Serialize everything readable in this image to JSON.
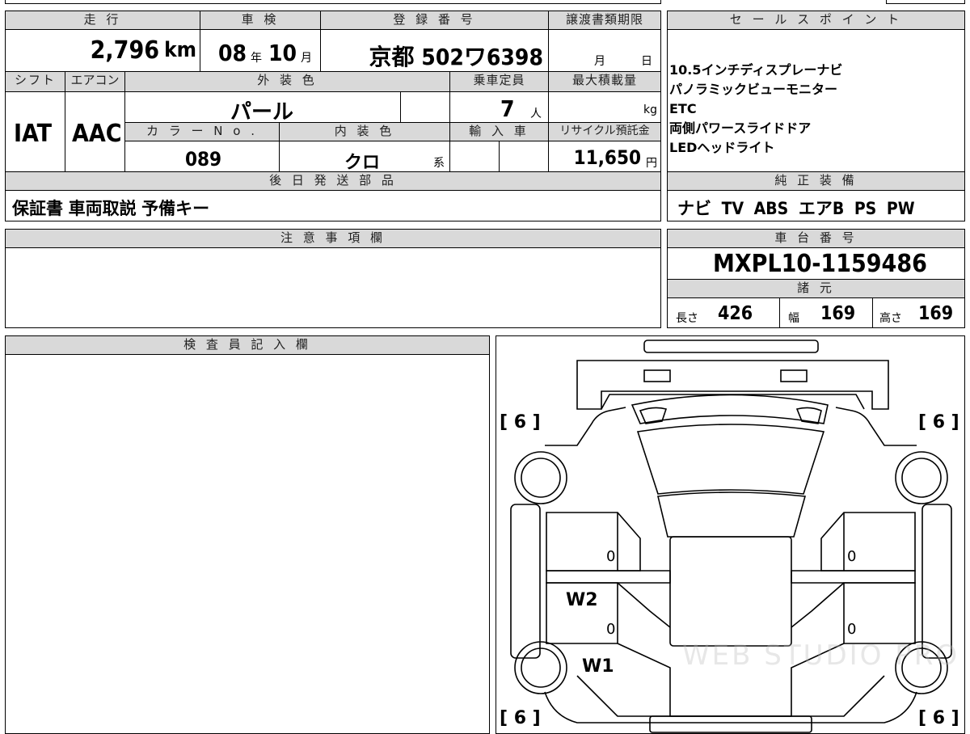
{
  "headers": {
    "mileage": "走 行",
    "inspection": "車 検",
    "registration": "登 録 番 号",
    "transfer_deadline": "譲渡書類期限",
    "sales_points": "セ ー ル ス ポ イ ン ト",
    "shift": "シフト",
    "aircon": "エアコン",
    "exterior_color": "外 装 色",
    "capacity": "乗車定員",
    "max_load": "最大積載量",
    "color_no": "カ ラ ー N o .",
    "interior_color": "内 装 色",
    "import": "輸 入 車",
    "recycle": "リサイクル預託金",
    "later_parts": "後 日 発 送 部 品",
    "genuine_equipment": "純 正 装 備",
    "notes": "注 意 事 項 欄",
    "chassis_no": "車 台 番 号",
    "specs": "諸 元",
    "inspector": "検 査 員 記 入 欄"
  },
  "mileage": {
    "value": "2,796",
    "unit": "km"
  },
  "inspection": {
    "year": "08",
    "year_unit": "年",
    "month": "10",
    "month_unit": "月"
  },
  "registration": {
    "value": "京都 502ワ6398"
  },
  "transfer_deadline": {
    "month_unit": "月",
    "day_unit": "日"
  },
  "shift": "IAT",
  "aircon": "AAC",
  "exterior_color": "パール",
  "capacity": {
    "value": "7",
    "unit": "人"
  },
  "max_load": {
    "unit": "kg"
  },
  "color_no": "089",
  "interior_color": {
    "value": "クロ",
    "suffix": "系"
  },
  "recycle": {
    "value": "11,650",
    "unit": "円"
  },
  "sales_points": [
    "10.5インチディスプレーナビ",
    "パノラミックビューモニター",
    "ETC",
    "両側パワースライドドア",
    "LEDヘッドライト"
  ],
  "later_parts": "保証書 車両取説 予備キー",
  "genuine_equipment": "ナビ TV ABS エアB PS PW",
  "chassis_no": "MXPL10-1159486",
  "specs": {
    "length_label": "長さ",
    "length": "426",
    "width_label": "幅",
    "width": "169",
    "height_label": "高さ",
    "height": "169"
  },
  "diagram": {
    "tire_fl": "[ 6 ]",
    "tire_fr": "[ 6 ]",
    "tire_rl": "[ 6 ]",
    "tire_rr": "[ 6 ]",
    "mark_w2": "W2",
    "mark_w1": "W1",
    "zero_1": "0",
    "zero_2": "0",
    "zero_3": "0",
    "zero_4": "0",
    "watermark": "WEB STUDIO PRO"
  }
}
